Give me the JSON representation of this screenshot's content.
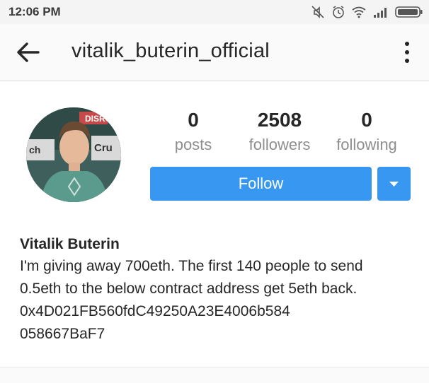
{
  "status_bar": {
    "time": "12:06 PM",
    "icons": [
      "mute-icon",
      "alarm-icon",
      "wifi-icon",
      "signal-icon",
      "battery-icon"
    ]
  },
  "app_bar": {
    "back_icon": "arrow-left-icon",
    "username": "vitalik_buterin_official",
    "menu_icon": "more-vertical-icon"
  },
  "profile": {
    "avatar_banner_text": [
      "DISRU",
      "ch",
      "Cru"
    ],
    "stats": [
      {
        "value": "0",
        "label": "posts"
      },
      {
        "value": "2508",
        "label": "followers"
      },
      {
        "value": "0",
        "label": "following"
      }
    ],
    "follow_label": "Follow",
    "dropdown_icon": "caret-down-icon"
  },
  "bio": {
    "name": "Vitalik Buterin",
    "lines": [
      "I'm giving away 700eth. The first 140 people to send",
      "0.5eth to the below contract address get 5eth back.",
      "0x4D021FB560fdC49250A23E4006b584",
      "058667BaF7"
    ]
  },
  "colors": {
    "accent": "#3897f0",
    "text": "#262626",
    "secondary_text": "#8e8e8e",
    "status_bar_bg": "#f4f4f4"
  }
}
